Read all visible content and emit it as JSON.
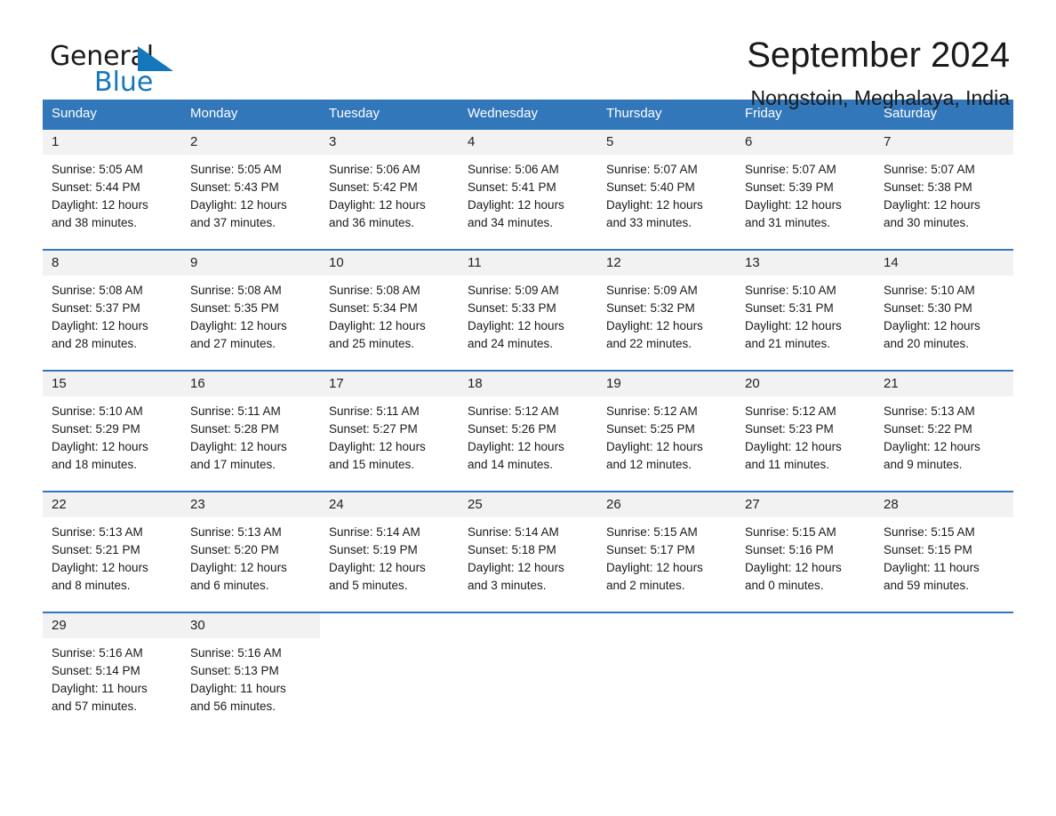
{
  "brand": {
    "name_first": "General",
    "name_second": "Blue",
    "triangle_icon": "triangle-icon",
    "primary_color": "#1477bc"
  },
  "header": {
    "title": "September 2024",
    "location": "Nongstoin, Meghalaya, India"
  },
  "calendar": {
    "header_color": "#3377bb",
    "weekdays": [
      "Sunday",
      "Monday",
      "Tuesday",
      "Wednesday",
      "Thursday",
      "Friday",
      "Saturday"
    ],
    "weeks": [
      [
        {
          "day": "1",
          "sunrise": "Sunrise: 5:05 AM",
          "sunset": "Sunset: 5:44 PM",
          "daylight_line1": "Daylight: 12 hours",
          "daylight_line2": "and 38 minutes."
        },
        {
          "day": "2",
          "sunrise": "Sunrise: 5:05 AM",
          "sunset": "Sunset: 5:43 PM",
          "daylight_line1": "Daylight: 12 hours",
          "daylight_line2": "and 37 minutes."
        },
        {
          "day": "3",
          "sunrise": "Sunrise: 5:06 AM",
          "sunset": "Sunset: 5:42 PM",
          "daylight_line1": "Daylight: 12 hours",
          "daylight_line2": "and 36 minutes."
        },
        {
          "day": "4",
          "sunrise": "Sunrise: 5:06 AM",
          "sunset": "Sunset: 5:41 PM",
          "daylight_line1": "Daylight: 12 hours",
          "daylight_line2": "and 34 minutes."
        },
        {
          "day": "5",
          "sunrise": "Sunrise: 5:07 AM",
          "sunset": "Sunset: 5:40 PM",
          "daylight_line1": "Daylight: 12 hours",
          "daylight_line2": "and 33 minutes."
        },
        {
          "day": "6",
          "sunrise": "Sunrise: 5:07 AM",
          "sunset": "Sunset: 5:39 PM",
          "daylight_line1": "Daylight: 12 hours",
          "daylight_line2": "and 31 minutes."
        },
        {
          "day": "7",
          "sunrise": "Sunrise: 5:07 AM",
          "sunset": "Sunset: 5:38 PM",
          "daylight_line1": "Daylight: 12 hours",
          "daylight_line2": "and 30 minutes."
        }
      ],
      [
        {
          "day": "8",
          "sunrise": "Sunrise: 5:08 AM",
          "sunset": "Sunset: 5:37 PM",
          "daylight_line1": "Daylight: 12 hours",
          "daylight_line2": "and 28 minutes."
        },
        {
          "day": "9",
          "sunrise": "Sunrise: 5:08 AM",
          "sunset": "Sunset: 5:35 PM",
          "daylight_line1": "Daylight: 12 hours",
          "daylight_line2": "and 27 minutes."
        },
        {
          "day": "10",
          "sunrise": "Sunrise: 5:08 AM",
          "sunset": "Sunset: 5:34 PM",
          "daylight_line1": "Daylight: 12 hours",
          "daylight_line2": "and 25 minutes."
        },
        {
          "day": "11",
          "sunrise": "Sunrise: 5:09 AM",
          "sunset": "Sunset: 5:33 PM",
          "daylight_line1": "Daylight: 12 hours",
          "daylight_line2": "and 24 minutes."
        },
        {
          "day": "12",
          "sunrise": "Sunrise: 5:09 AM",
          "sunset": "Sunset: 5:32 PM",
          "daylight_line1": "Daylight: 12 hours",
          "daylight_line2": "and 22 minutes."
        },
        {
          "day": "13",
          "sunrise": "Sunrise: 5:10 AM",
          "sunset": "Sunset: 5:31 PM",
          "daylight_line1": "Daylight: 12 hours",
          "daylight_line2": "and 21 minutes."
        },
        {
          "day": "14",
          "sunrise": "Sunrise: 5:10 AM",
          "sunset": "Sunset: 5:30 PM",
          "daylight_line1": "Daylight: 12 hours",
          "daylight_line2": "and 20 minutes."
        }
      ],
      [
        {
          "day": "15",
          "sunrise": "Sunrise: 5:10 AM",
          "sunset": "Sunset: 5:29 PM",
          "daylight_line1": "Daylight: 12 hours",
          "daylight_line2": "and 18 minutes."
        },
        {
          "day": "16",
          "sunrise": "Sunrise: 5:11 AM",
          "sunset": "Sunset: 5:28 PM",
          "daylight_line1": "Daylight: 12 hours",
          "daylight_line2": "and 17 minutes."
        },
        {
          "day": "17",
          "sunrise": "Sunrise: 5:11 AM",
          "sunset": "Sunset: 5:27 PM",
          "daylight_line1": "Daylight: 12 hours",
          "daylight_line2": "and 15 minutes."
        },
        {
          "day": "18",
          "sunrise": "Sunrise: 5:12 AM",
          "sunset": "Sunset: 5:26 PM",
          "daylight_line1": "Daylight: 12 hours",
          "daylight_line2": "and 14 minutes."
        },
        {
          "day": "19",
          "sunrise": "Sunrise: 5:12 AM",
          "sunset": "Sunset: 5:25 PM",
          "daylight_line1": "Daylight: 12 hours",
          "daylight_line2": "and 12 minutes."
        },
        {
          "day": "20",
          "sunrise": "Sunrise: 5:12 AM",
          "sunset": "Sunset: 5:23 PM",
          "daylight_line1": "Daylight: 12 hours",
          "daylight_line2": "and 11 minutes."
        },
        {
          "day": "21",
          "sunrise": "Sunrise: 5:13 AM",
          "sunset": "Sunset: 5:22 PM",
          "daylight_line1": "Daylight: 12 hours",
          "daylight_line2": "and 9 minutes."
        }
      ],
      [
        {
          "day": "22",
          "sunrise": "Sunrise: 5:13 AM",
          "sunset": "Sunset: 5:21 PM",
          "daylight_line1": "Daylight: 12 hours",
          "daylight_line2": "and 8 minutes."
        },
        {
          "day": "23",
          "sunrise": "Sunrise: 5:13 AM",
          "sunset": "Sunset: 5:20 PM",
          "daylight_line1": "Daylight: 12 hours",
          "daylight_line2": "and 6 minutes."
        },
        {
          "day": "24",
          "sunrise": "Sunrise: 5:14 AM",
          "sunset": "Sunset: 5:19 PM",
          "daylight_line1": "Daylight: 12 hours",
          "daylight_line2": "and 5 minutes."
        },
        {
          "day": "25",
          "sunrise": "Sunrise: 5:14 AM",
          "sunset": "Sunset: 5:18 PM",
          "daylight_line1": "Daylight: 12 hours",
          "daylight_line2": "and 3 minutes."
        },
        {
          "day": "26",
          "sunrise": "Sunrise: 5:15 AM",
          "sunset": "Sunset: 5:17 PM",
          "daylight_line1": "Daylight: 12 hours",
          "daylight_line2": "and 2 minutes."
        },
        {
          "day": "27",
          "sunrise": "Sunrise: 5:15 AM",
          "sunset": "Sunset: 5:16 PM",
          "daylight_line1": "Daylight: 12 hours",
          "daylight_line2": "and 0 minutes."
        },
        {
          "day": "28",
          "sunrise": "Sunrise: 5:15 AM",
          "sunset": "Sunset: 5:15 PM",
          "daylight_line1": "Daylight: 11 hours",
          "daylight_line2": "and 59 minutes."
        }
      ],
      [
        {
          "day": "29",
          "sunrise": "Sunrise: 5:16 AM",
          "sunset": "Sunset: 5:14 PM",
          "daylight_line1": "Daylight: 11 hours",
          "daylight_line2": "and 57 minutes."
        },
        {
          "day": "30",
          "sunrise": "Sunrise: 5:16 AM",
          "sunset": "Sunset: 5:13 PM",
          "daylight_line1": "Daylight: 11 hours",
          "daylight_line2": "and 56 minutes."
        },
        {
          "day": "",
          "sunrise": "",
          "sunset": "",
          "daylight_line1": "",
          "daylight_line2": ""
        },
        {
          "day": "",
          "sunrise": "",
          "sunset": "",
          "daylight_line1": "",
          "daylight_line2": ""
        },
        {
          "day": "",
          "sunrise": "",
          "sunset": "",
          "daylight_line1": "",
          "daylight_line2": ""
        },
        {
          "day": "",
          "sunrise": "",
          "sunset": "",
          "daylight_line1": "",
          "daylight_line2": ""
        },
        {
          "day": "",
          "sunrise": "",
          "sunset": "",
          "daylight_line1": "",
          "daylight_line2": ""
        }
      ]
    ]
  }
}
